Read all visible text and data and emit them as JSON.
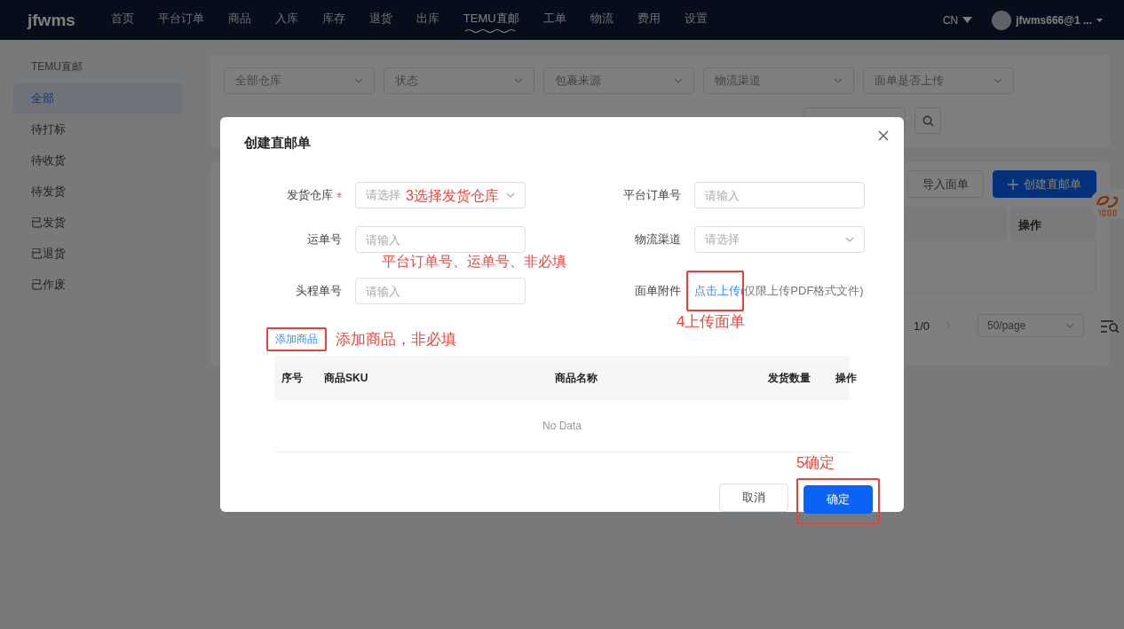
{
  "nav": {
    "logo": "jfwms",
    "items": [
      {
        "label": "首页",
        "selected": false
      },
      {
        "label": "平台订单",
        "selected": false
      },
      {
        "label": "商品",
        "selected": false
      },
      {
        "label": "入库",
        "selected": false
      },
      {
        "label": "库存",
        "selected": false
      },
      {
        "label": "退货",
        "selected": false
      },
      {
        "label": "出库",
        "selected": false
      },
      {
        "label": "TEMU直邮",
        "selected": true
      },
      {
        "label": "工单",
        "selected": false
      },
      {
        "label": "物流",
        "selected": false
      },
      {
        "label": "费用",
        "selected": false
      },
      {
        "label": "设置",
        "selected": false
      }
    ],
    "language": "CN",
    "user": "jfwms666@1 ..."
  },
  "sidebar": {
    "title": "TEMU直邮",
    "items": [
      {
        "label": "全部",
        "selected": true
      },
      {
        "label": "待打标",
        "selected": false
      },
      {
        "label": "待收货",
        "selected": false
      },
      {
        "label": "待发货",
        "selected": false
      },
      {
        "label": "已发货",
        "selected": false
      },
      {
        "label": "已退货",
        "selected": false
      },
      {
        "label": "已作废",
        "selected": false
      }
    ]
  },
  "filters": [
    {
      "placeholder": "全部仓库"
    },
    {
      "placeholder": "状态"
    },
    {
      "placeholder": "包裹来源"
    },
    {
      "placeholder": "物流渠道"
    },
    {
      "placeholder": "面单是否上传"
    }
  ],
  "toolbar": {
    "buttons": [
      {
        "label": "导入面单",
        "kind": "default"
      },
      {
        "label": "创建直邮单",
        "kind": "primary"
      }
    ]
  },
  "table": {
    "columns": [
      "操作"
    ]
  },
  "pagination": {
    "page": "1/0",
    "page_size": "50/page"
  },
  "modal": {
    "title": "创建直邮单",
    "fields": [
      {
        "label": "发货仓库",
        "required": true,
        "kind": "select",
        "placeholder": "请选择"
      },
      {
        "label": "平台订单号",
        "required": false,
        "kind": "input",
        "placeholder": "请输入"
      },
      {
        "label": "运单号",
        "required": false,
        "kind": "input",
        "placeholder": "请输入"
      },
      {
        "label": "物流渠道",
        "required": false,
        "kind": "select",
        "placeholder": "请选择"
      },
      {
        "label": "头程单号",
        "required": false,
        "kind": "input",
        "placeholder": "请输入"
      },
      {
        "label": "面单附件",
        "required": false,
        "kind": "upload",
        "link": "点击上传",
        "hint": "(仅限上传PDF格式文件)"
      }
    ],
    "add_link": "添加商品",
    "table": {
      "columns": [
        "序号",
        "商品SKU",
        "商品名称",
        "发货数量",
        "操作"
      ],
      "empty_text": "No Data"
    },
    "buttons": [
      {
        "label": "取消",
        "kind": "default"
      },
      {
        "label": "确定",
        "kind": "primary"
      }
    ]
  },
  "annotations": [
    "3选择发货仓库",
    "平台订单号、运单号、非必填",
    "添加商品，非必填",
    "4上传面单",
    "5确定"
  ]
}
